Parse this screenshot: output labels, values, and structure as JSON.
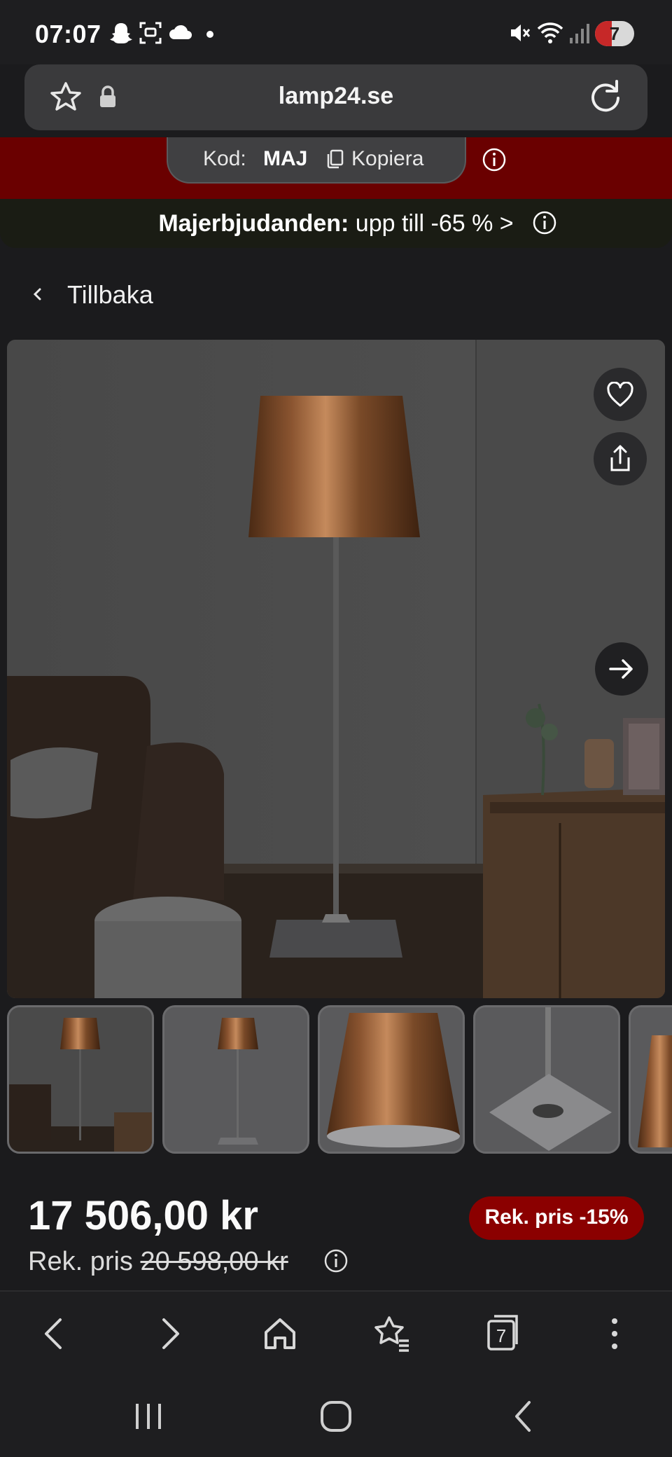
{
  "status_bar": {
    "time": "07:07",
    "battery": "7",
    "icons": [
      "snapchat-icon",
      "scan-icon",
      "cloud-icon",
      "dot-icon",
      "mute-icon",
      "wifi-icon",
      "signal-icon",
      "battery-icon"
    ]
  },
  "browser": {
    "url": "lamp24.se",
    "icons": [
      "bookmark-star-icon",
      "lock-icon",
      "reload-icon"
    ]
  },
  "promo": {
    "code_label": "Kod:",
    "code": "MAJ",
    "copy_label": "Kopiera",
    "headline_bold": "Majerbjudanden:",
    "headline_rest": " upp till -65 % >"
  },
  "back_label": "Tillbaka",
  "gallery": {
    "thumbnail_count": 5,
    "icons": [
      "heart-icon",
      "share-icon",
      "arrow-right-icon"
    ]
  },
  "price": {
    "current": "17 506,00 kr",
    "rek_label": "Rek. pris ",
    "rek_value": "20 598,00 kr",
    "discount_badge": "Rek. pris -15%"
  },
  "browser_nav": {
    "tab_count": "7",
    "icons": [
      "back-icon",
      "forward-icon",
      "home-icon",
      "bookmarks-icon",
      "tabs-icon",
      "more-icon"
    ]
  },
  "colors": {
    "promo_red": "#6a0000",
    "badge_red": "#8b0000",
    "background": "#1b1b1d"
  }
}
